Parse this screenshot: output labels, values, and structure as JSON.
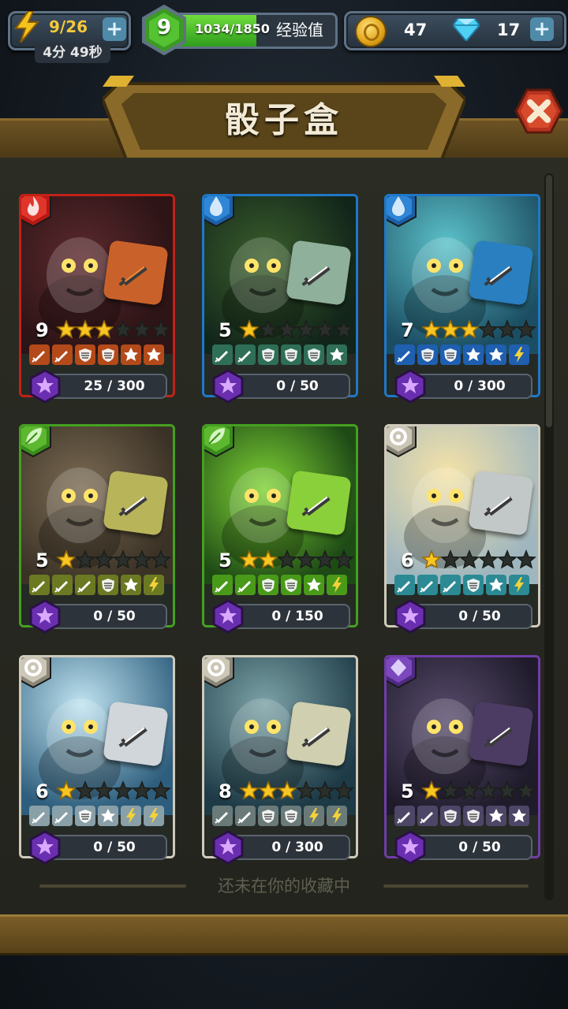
{
  "top_bar": {
    "energy": "9/26",
    "energy_timer": "4分 49秒",
    "level": "9",
    "xp": "1034/1850",
    "xp_fraction": 0.559,
    "xp_label": "经验值",
    "coins": "47",
    "gems": "17",
    "plus_label": "+"
  },
  "title": "骰子盒",
  "footer_note": "还未在你的收藏中",
  "cards": [
    {
      "element": "fire",
      "art": "fire",
      "level": "9",
      "stars": 3,
      "progress": "25 / 300",
      "fraction": 0.083,
      "dice_color": "#c9622a",
      "faces": [
        "sword",
        "sword",
        "shield",
        "shield",
        "star",
        "star"
      ],
      "face_bg": "#b44a1a"
    },
    {
      "element": "water",
      "art": "water1",
      "level": "5",
      "stars": 1,
      "progress": "0 / 50",
      "fraction": 0,
      "dice_color": "#8fb09a",
      "faces": [
        "sword",
        "sword",
        "shield",
        "shield",
        "shield",
        "star"
      ],
      "face_bg": "#2f6f58"
    },
    {
      "element": "water",
      "art": "water2",
      "level": "7",
      "stars": 3,
      "progress": "0 / 300",
      "fraction": 0,
      "dice_color": "#2a7fc0",
      "faces": [
        "sword",
        "shield",
        "shield",
        "star",
        "star",
        "bolt"
      ],
      "face_bg": "#1f5fb0"
    },
    {
      "element": "nature",
      "art": "nature1",
      "level": "5",
      "stars": 1,
      "progress": "0 / 50",
      "fraction": 0,
      "dice_color": "#b8b45a",
      "faces": [
        "sword",
        "sword",
        "sword",
        "shield",
        "star",
        "bolt"
      ],
      "face_bg": "#6b7a22"
    },
    {
      "element": "nature",
      "art": "nature2",
      "level": "5",
      "stars": 2,
      "progress": "0 / 150",
      "fraction": 0,
      "dice_color": "#8ad03a",
      "faces": [
        "sword",
        "sword",
        "shield",
        "shield",
        "star",
        "bolt"
      ],
      "face_bg": "#4a9a1a"
    },
    {
      "element": "neutral",
      "art": "neutral1",
      "level": "6",
      "stars": 1,
      "progress": "0 / 50",
      "fraction": 0,
      "dice_color": "#c2c8c8",
      "faces": [
        "sword",
        "sword",
        "sword",
        "shield",
        "star",
        "bolt"
      ],
      "face_bg": "#2b8a93"
    },
    {
      "element": "neutral",
      "art": "neutral2",
      "level": "6",
      "stars": 1,
      "progress": "0 / 50",
      "fraction": 0,
      "dice_color": "#d0d6da",
      "faces": [
        "sword",
        "sword",
        "shield",
        "star",
        "bolt",
        "bolt"
      ],
      "face_bg": "#8aa0a8"
    },
    {
      "element": "neutral",
      "art": "neutral3",
      "level": "8",
      "stars": 3,
      "progress": "0 / 300",
      "fraction": 0,
      "dice_color": "#d0cfb0",
      "faces": [
        "sword",
        "sword",
        "shield",
        "shield",
        "bolt",
        "bolt"
      ],
      "face_bg": "#6a7a78"
    },
    {
      "element": "void",
      "art": "void",
      "level": "5",
      "stars": 1,
      "progress": "0 / 50",
      "fraction": 0,
      "dice_color": "#4c3c63",
      "faces": [
        "sword",
        "sword",
        "shield",
        "shield",
        "star",
        "star"
      ],
      "face_bg": "#4e4666"
    }
  ]
}
